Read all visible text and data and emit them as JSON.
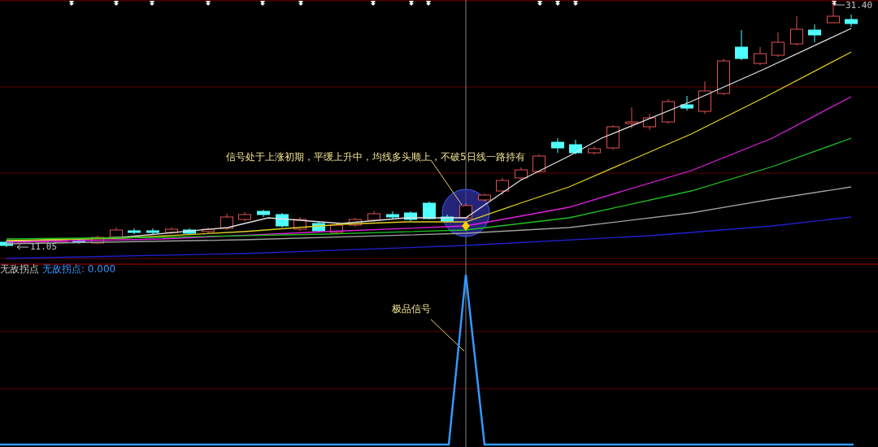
{
  "price_chart": {
    "high_label": "31.40",
    "low_label": "11.05",
    "annotation": "信号处于上涨初期，平缓上升中，均线多头顺上，不破5日线一路持有"
  },
  "indicator": {
    "name": "无敌拐点",
    "reading": "无敌拐点: 0.000",
    "annotation": "极品信号"
  }
}
